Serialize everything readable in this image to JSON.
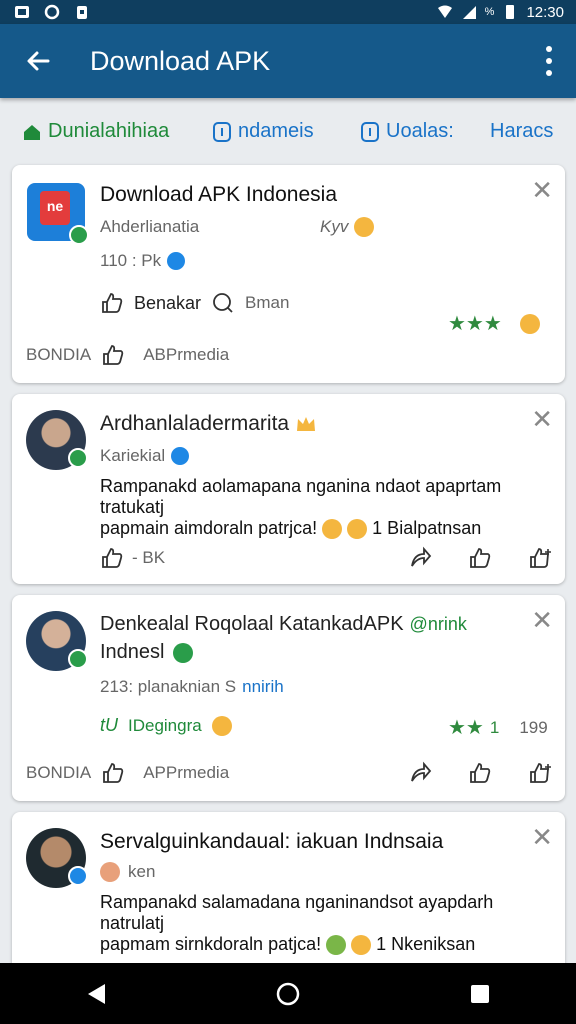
{
  "status_bar": {
    "time": "12:30",
    "battery": "%"
  },
  "app_bar": {
    "title": "Download APK"
  },
  "filters": [
    {
      "label": "Dunialahihiaa"
    },
    {
      "label": "ndameis"
    },
    {
      "label": "Uoalas:"
    },
    {
      "label": "Haracs"
    }
  ],
  "cards": [
    {
      "title": "Download APK Indonesia",
      "subtitle": "Ahderlianatia",
      "tag": "Kyv",
      "meta": "110 : Pk",
      "actions": {
        "like": "Benakar",
        "comment": "Bman"
      },
      "footer": "BONDIA",
      "footer_source": "ABPrmedia"
    },
    {
      "name": "Ardhanlaladermarita",
      "handle": "Kariekial",
      "text_line1": "Rampanakd aolamapana nganina ndaot apaprtam",
      "text_line2": "tratukatj",
      "text_line3": "papmain aimdoraln patrjca!",
      "text_line3_tail": "1 Bialpatnsan",
      "stat": "- BK"
    },
    {
      "name_line1": "Denkealal Roqolaal KatankadAPK",
      "name_extra": "@nrink",
      "name_line2": "Indnesl",
      "meta": "213: planaknian S",
      "meta_tail": "nnirih",
      "reaction": "IDegingra",
      "reaction_prefix": "tU",
      "count": "199",
      "star_count": "1",
      "footer": "BONDIA",
      "footer_source": "APPrmedia"
    },
    {
      "name": "Servalguinkandaual: iakuan Indnsaia",
      "handle": "ken",
      "text_line1": "Rampanakd salamadana nganinandsot ayapdarh",
      "text_line2": "natrulatj",
      "text_line3": "papmam sirnkdoraln patjca!",
      "text_line3_tail": "1 Nkeniksan"
    }
  ],
  "colors": {
    "status": "#0f3e5f",
    "appbar": "#15598a",
    "accent": "#1a73c8",
    "green": "#1f8a3a"
  }
}
